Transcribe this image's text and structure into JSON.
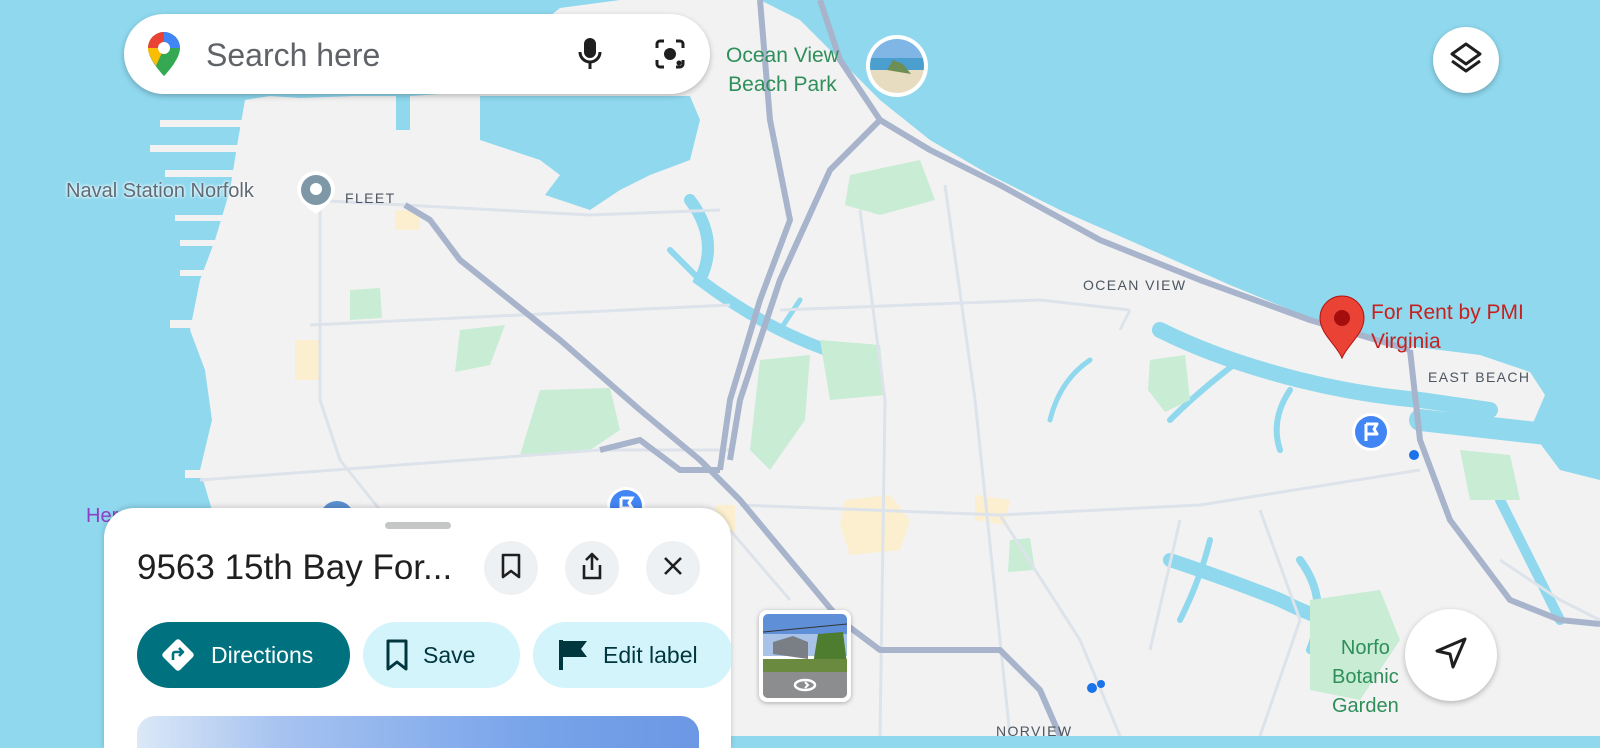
{
  "search": {
    "placeholder": "Search here"
  },
  "map_labels": {
    "ocean_view_beach_park": "Ocean View\nBeach Park",
    "naval_station_norfolk": "Naval Station Norfolk",
    "fleet": "FLEET",
    "ocean_view": "OCEAN VIEW",
    "for_rent": "For Rent by PMI\nVirginia",
    "east_beach": "EAST BEACH",
    "norview": "NORVIEW",
    "norfolk_botanical_garden": "Norfo\nBotanic\nGarden",
    "hermitage_partial": "Herr"
  },
  "place_sheet": {
    "title": "9563 15th Bay For...",
    "directions_label": "Directions",
    "save_label": "Save",
    "edit_label_label": "Edit label"
  },
  "icons": {
    "app_pin": "google-maps-pin-icon",
    "mic": "mic-icon",
    "lens": "lens-camera-icon",
    "layers": "layers-icon",
    "bookmark": "bookmark-icon",
    "share": "share-icon",
    "close": "close-icon",
    "directions": "directions-icon",
    "save": "bookmark-icon",
    "label": "flag-icon",
    "recenter": "navigation-arrow-icon",
    "street_view": "street-view-rotate-icon"
  },
  "colors": {
    "water": "#8fd8ee",
    "land": "#f2f2f2",
    "road": "#a7b4cc",
    "park": "#c8ecd4",
    "accent": "#00727f",
    "chip_bg": "#d3f4fb",
    "pin_red": "#ea4335"
  }
}
